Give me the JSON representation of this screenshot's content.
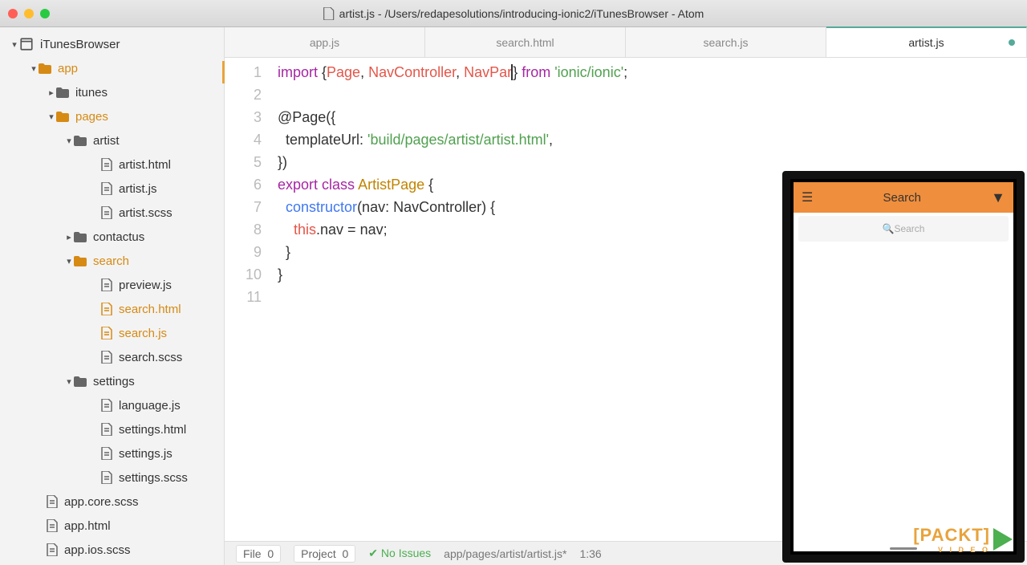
{
  "window": {
    "title": "artist.js - /Users/redapesolutions/introducing-ionic2/iTunesBrowser - Atom"
  },
  "tree": {
    "root": "iTunesBrowser",
    "app": "app",
    "itunes": "itunes",
    "pages": "pages",
    "artist": "artist",
    "artist_html": "artist.html",
    "artist_js": "artist.js",
    "artist_scss": "artist.scss",
    "contactus": "contactus",
    "search": "search",
    "preview_js": "preview.js",
    "search_html": "search.html",
    "search_js": "search.js",
    "search_scss": "search.scss",
    "settings": "settings",
    "language_js": "language.js",
    "settings_html": "settings.html",
    "settings_js": "settings.js",
    "settings_scss": "settings.scss",
    "app_core_scss": "app.core.scss",
    "app_html": "app.html",
    "app_ios_scss": "app.ios.scss"
  },
  "tabs": {
    "t1": "app.js",
    "t2": "search.html",
    "t3": "search.js",
    "t4": "artist.js"
  },
  "code": {
    "l1a": "import",
    "l1b": " {",
    "l1c": "Page",
    "l1d": ", ",
    "l1e": "NavController",
    "l1f": ", ",
    "l1g": "NavPar",
    "l1h": "} ",
    "l1i": "from",
    "l1j": " ",
    "l1k": "'ionic/ionic'",
    "l1l": ";",
    "l3a": "@Page({",
    "l4a": "  templateUrl: ",
    "l4b": "'build/pages/artist/artist.html'",
    "l4c": ",",
    "l5a": "})",
    "l6a": "export",
    "l6b": " ",
    "l6c": "class",
    "l6d": " ",
    "l6e": "ArtistPage",
    "l6f": " {",
    "l7a": "  ",
    "l7b": "constructor",
    "l7c": "(nav: NavController) {",
    "l8a": "    ",
    "l8b": "this",
    "l8c": ".nav = nav;",
    "l9a": "  }",
    "l10a": "}",
    "n1": "1",
    "n2": "2",
    "n3": "3",
    "n4": "4",
    "n5": "5",
    "n6": "6",
    "n7": "7",
    "n8": "8",
    "n9": "9",
    "n10": "10",
    "n11": "11"
  },
  "status": {
    "file": "File",
    "file_c": "0",
    "project": "Project",
    "project_c": "0",
    "issues": "No Issues",
    "path": "app/pages/artist/artist.js*",
    "pos": "1:36"
  },
  "device": {
    "title": "Search",
    "placeholder": "Search"
  },
  "brand": {
    "a": "[PACKT]",
    "b": "V I D E O"
  }
}
